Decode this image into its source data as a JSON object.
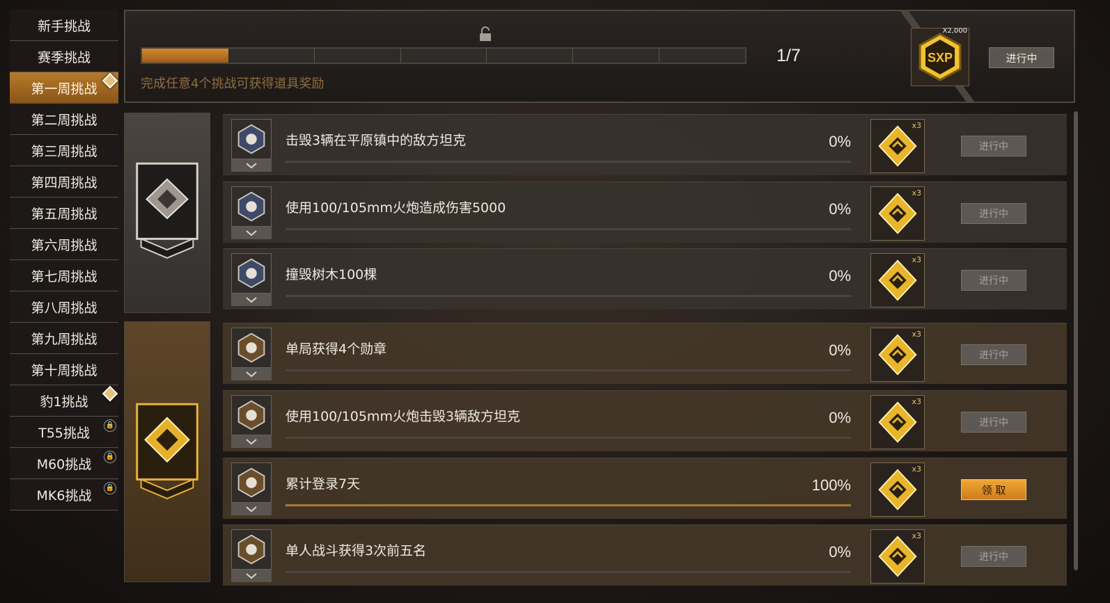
{
  "sidebar": {
    "items": [
      {
        "label": "新手挑战",
        "active": false,
        "badge": "none"
      },
      {
        "label": "赛季挑战",
        "active": false,
        "badge": "none"
      },
      {
        "label": "第一周挑战",
        "active": true,
        "badge": "diamond"
      },
      {
        "label": "第二周挑战",
        "active": false,
        "badge": "none"
      },
      {
        "label": "第三周挑战",
        "active": false,
        "badge": "none"
      },
      {
        "label": "第四周挑战",
        "active": false,
        "badge": "none"
      },
      {
        "label": "第五周挑战",
        "active": false,
        "badge": "none"
      },
      {
        "label": "第六周挑战",
        "active": false,
        "badge": "none"
      },
      {
        "label": "第七周挑战",
        "active": false,
        "badge": "none"
      },
      {
        "label": "第八周挑战",
        "active": false,
        "badge": "none"
      },
      {
        "label": "第九周挑战",
        "active": false,
        "badge": "none"
      },
      {
        "label": "第十周挑战",
        "active": false,
        "badge": "none"
      },
      {
        "label": "豹1挑战",
        "active": false,
        "badge": "diamond"
      },
      {
        "label": "T55挑战",
        "active": false,
        "badge": "lock"
      },
      {
        "label": "M60挑战",
        "active": false,
        "badge": "lock"
      },
      {
        "label": "MK6挑战",
        "active": false,
        "badge": "lock"
      }
    ]
  },
  "progress": {
    "count": "1/7",
    "description": "完成任意4个挑战可获得道具奖励",
    "fraction": 0.143
  },
  "reward_summary": {
    "multiplier": "X2,000",
    "icon_text": "SXP",
    "status": "进行中"
  },
  "tasks": [
    {
      "text": "击毁3辆在平原镇中的敌方坦克",
      "percent": "0%",
      "progress": 0,
      "reward_mult": "x3",
      "button": "进行中",
      "claim": false,
      "group": 1,
      "icon": "tank-shell-icon"
    },
    {
      "text": "使用100/105mm火炮造成伤害5000",
      "percent": "0%",
      "progress": 0,
      "reward_mult": "x3",
      "button": "进行中",
      "claim": false,
      "group": 1,
      "icon": "cannon-icon"
    },
    {
      "text": "撞毁树木100棵",
      "percent": "0%",
      "progress": 0,
      "reward_mult": "x3",
      "button": "进行中",
      "claim": false,
      "group": 1,
      "icon": "car-crash-icon"
    },
    {
      "text": "单局获得4个勋章",
      "percent": "0%",
      "progress": 0,
      "reward_mult": "x3",
      "button": "进行中",
      "claim": false,
      "group": 2,
      "icon": "medal-star-icon"
    },
    {
      "text": "使用100/105mm火炮击毁3辆敌方坦克",
      "percent": "0%",
      "progress": 0,
      "reward_mult": "x3",
      "button": "进行中",
      "claim": false,
      "group": 2,
      "icon": "cannon-icon"
    },
    {
      "text": "累计登录7天",
      "percent": "100%",
      "progress": 1,
      "reward_mult": "x3",
      "button": "领 取",
      "claim": true,
      "group": 2,
      "icon": "clock-icon"
    },
    {
      "text": "单人战斗获得3次前五名",
      "percent": "0%",
      "progress": 0,
      "reward_mult": "x3",
      "button": "进行中",
      "claim": false,
      "group": 2,
      "icon": "crown-icon"
    }
  ],
  "colors": {
    "accent": "#c5851f",
    "active_tab": "#a66a20",
    "claim": "#e69025"
  }
}
